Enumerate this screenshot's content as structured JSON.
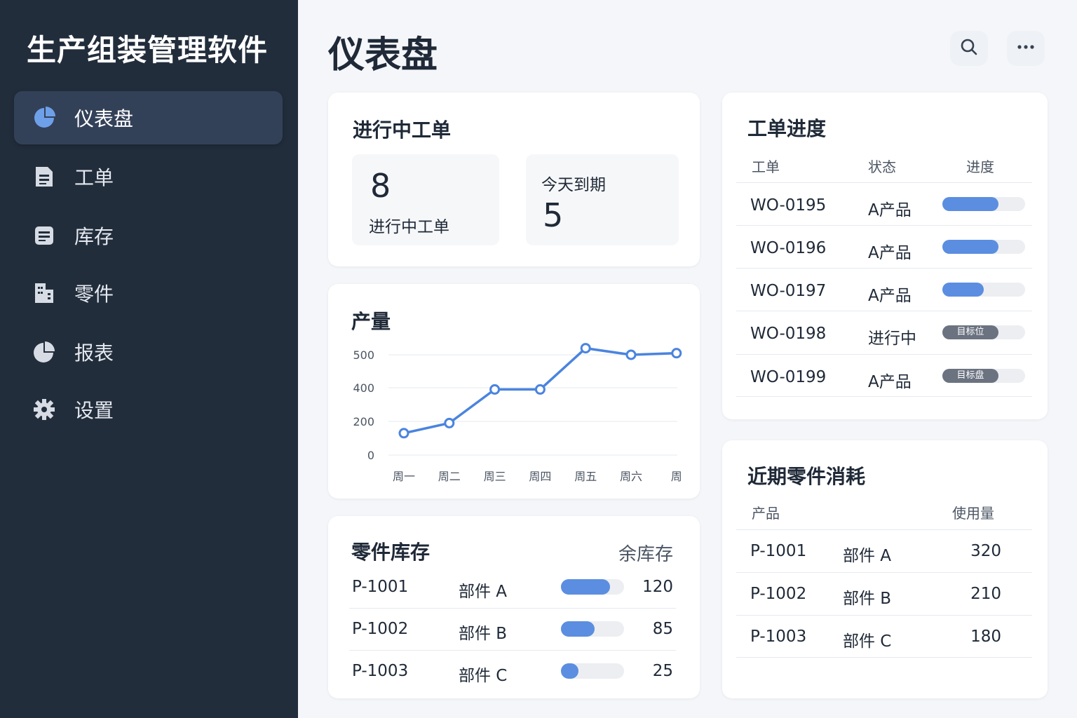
{
  "app": {
    "title": "生产组装管理软件"
  },
  "sidebar": {
    "items": [
      {
        "label": "仪表盘",
        "icon": "pie-chart-icon"
      },
      {
        "label": "工单",
        "icon": "document-icon"
      },
      {
        "label": "库存",
        "icon": "list-icon"
      },
      {
        "label": "零件",
        "icon": "parts-icon"
      },
      {
        "label": "报表",
        "icon": "report-pie-icon"
      },
      {
        "label": "设置",
        "icon": "gear-icon"
      }
    ],
    "active": "仪表盘"
  },
  "header": {
    "title": "仪表盘",
    "search_icon": "search-icon",
    "more_icon": "more-icon"
  },
  "work_orders_card": {
    "title": "进行中工单",
    "in_progress": {
      "value": "8",
      "label": "进行中工单"
    },
    "due_today": {
      "label": "今天到期",
      "value": "5"
    }
  },
  "output_card": {
    "title": "产量"
  },
  "chart_data": {
    "type": "line",
    "title": "产量",
    "categories": [
      "周一",
      "周二",
      "周三",
      "周四",
      "周五",
      "周六",
      "周"
    ],
    "series": [
      {
        "values": [
          130,
          190,
          390,
          390,
          520,
          500,
          505
        ]
      }
    ],
    "y_ticks": [
      "0",
      "200",
      "400",
      "500"
    ],
    "grid": true,
    "color": "#4a84df"
  },
  "progress_card": {
    "title": "工单进度",
    "headers": [
      "工单",
      "状态",
      "进度"
    ],
    "rows": [
      {
        "id": "WO-0195",
        "status": "A产品",
        "progress": 0.68
      },
      {
        "id": "WO-0196",
        "status": "A产品",
        "progress": 0.68
      },
      {
        "id": "WO-0197",
        "status": "A产品",
        "progress": 0.5
      },
      {
        "id": "WO-0198",
        "status": "进行中",
        "badge": "目标位"
      },
      {
        "id": "WO-0199",
        "status": "A产品",
        "badge": "目标盘"
      }
    ]
  },
  "inventory_card": {
    "title": "零件库存",
    "header_right": "余库存",
    "rows": [
      {
        "id": "P-1001",
        "name": "部件 A",
        "level": 0.78,
        "qty": "120"
      },
      {
        "id": "P-1002",
        "name": "部件 B",
        "level": 0.53,
        "qty": "85"
      },
      {
        "id": "P-1003",
        "name": "部件 C",
        "level": 0.28,
        "qty": "25"
      }
    ]
  },
  "consumption_card": {
    "title": "近期零件消耗",
    "headers": [
      "产品",
      "使用量"
    ],
    "rows": [
      {
        "id": "P-1001",
        "name": "部件 A",
        "qty": "320"
      },
      {
        "id": "P-1002",
        "name": "部件 B",
        "qty": "210"
      },
      {
        "id": "P-1003",
        "name": "部件 C",
        "qty": "180"
      }
    ]
  }
}
